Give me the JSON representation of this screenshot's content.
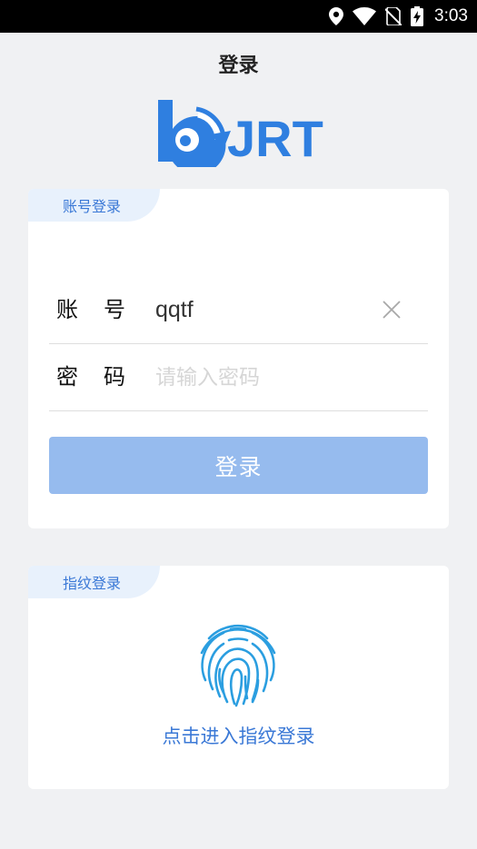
{
  "status_bar": {
    "time": "3:03",
    "icons": [
      "location-icon",
      "wifi-icon",
      "no-sim-icon",
      "battery-charging-icon"
    ]
  },
  "header": {
    "title": "登录"
  },
  "logo": {
    "text": "JRT",
    "color": "#2f7fe0"
  },
  "account_card": {
    "tag": "账号登录",
    "username": {
      "label": "账号",
      "value": "qqtf"
    },
    "password": {
      "label": "密码",
      "placeholder": "请输入密码"
    },
    "login_button": "登录"
  },
  "fingerprint_card": {
    "tag": "指纹登录",
    "action_text": "点击进入指纹登录"
  },
  "colors": {
    "accent": "#3a78d6",
    "button": "#96bbee",
    "tag_background": "#e8f1fc",
    "page_background": "#f0f1f3"
  }
}
